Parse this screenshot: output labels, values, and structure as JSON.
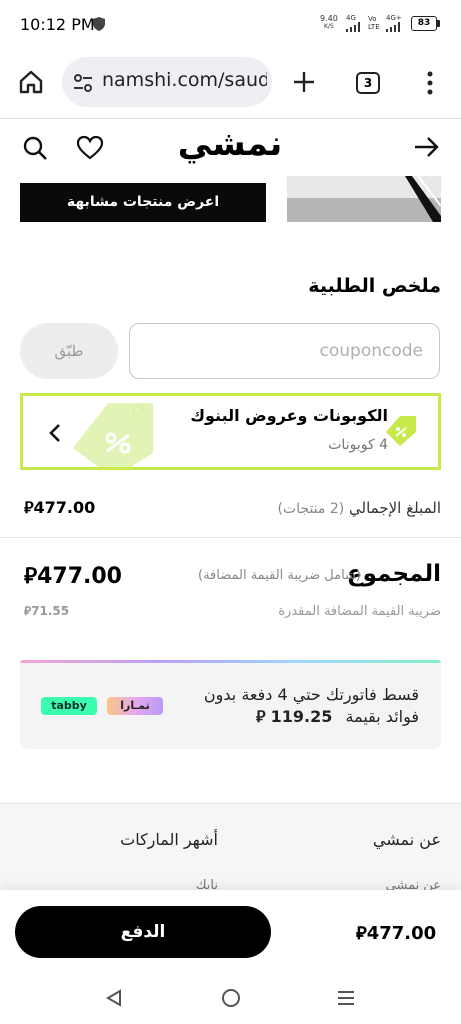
{
  "status_bar": {
    "time": "10:12 PM",
    "net_speed_value": "9.40",
    "net_speed_unit": "K/S",
    "signal_1": "4G",
    "signal_2": "Vo LTE",
    "signal_3": "4G+",
    "battery": "83"
  },
  "browser": {
    "url": "namshi.com/saud",
    "tab_count": "3"
  },
  "header": {
    "logo": "نمشي"
  },
  "similar_button": "اعرض منتجات مشابهة",
  "summary": {
    "title": "ملخص الطلبية",
    "coupon_placeholder": "couponcode",
    "apply_label": "طبّق"
  },
  "promo": {
    "title": "الكوبونات وعروض البنوك",
    "subtitle": "4 كوبونات"
  },
  "subtotal": {
    "label": "المبلغ الإجمالي",
    "note": "(2 منتجات)",
    "value": "477.00"
  },
  "total": {
    "label": "المجموع",
    "note": "(شامل ضريبة القيمة المضافة)",
    "value": "477.00",
    "vat_label": "ضريبة القيمة المضافة المقدرة",
    "vat_value": "71.55"
  },
  "installments": {
    "line1": "قسط فاتورتك حتي 4 دفعة بدون",
    "line2": "فوائد بقيمة",
    "amount": "119.25",
    "tabby": "tabby",
    "tamara": "تمـارا"
  },
  "footer": {
    "col1_title": "عن نمشي",
    "col1_item": "عن نمشي",
    "col2_title": "أشهر الماركات",
    "col2_item": "نايك"
  },
  "checkout": {
    "pay_label": "الدفع",
    "total": "477.00"
  },
  "currency_symbol": "⃁",
  "colors": {
    "accent_green": "#c6ea4b",
    "tabby_green": "#3bfdb0",
    "black": "#000000"
  }
}
